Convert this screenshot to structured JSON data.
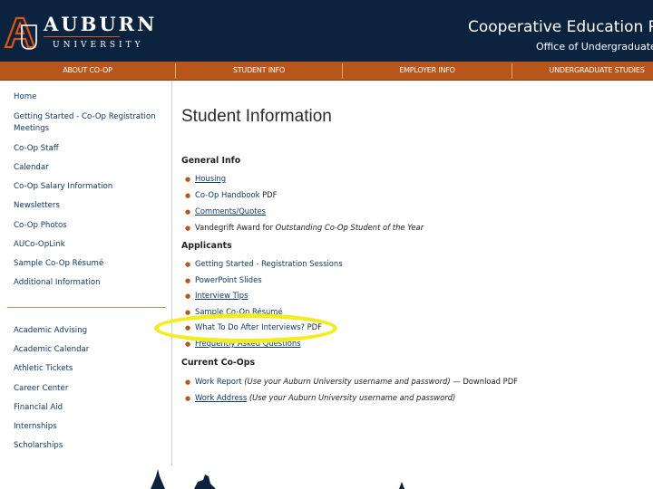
{
  "header": {
    "logo_word": "AUBURN",
    "logo_sub": "UNIVERSITY",
    "site_title": "Cooperative Education Progr",
    "site_subtitle": "Office of Undergraduate St"
  },
  "nav": {
    "items": [
      "ABOUT CO-OP",
      "STUDENT INFO",
      "EMPLOYER INFO",
      "UNDERGRADUATE STUDIES"
    ]
  },
  "sidebar": {
    "primary": [
      "Home",
      "Getting Started - Co-Op Registration",
      "Meetings",
      "Co-Op Staff",
      "Calendar",
      "Co-Op Salary Information",
      "Newsletters",
      "Co-Op Photos",
      "AUCo-OpLink",
      "Sample Co-Op Résumé",
      "Additional Information"
    ],
    "secondary": [
      "Academic Advising",
      "Academic Calendar",
      "Athletic Tickets",
      "Career Center",
      "Financial Aid",
      "Internships",
      "Scholarships"
    ]
  },
  "main": {
    "title": "Student Information",
    "general": {
      "heading": "General Info",
      "housing": "Housing",
      "handbook": "Co-Op Handbook",
      "handbook_pdf": "PDF",
      "comments": "Comments/Quotes",
      "award_prefix": "Vandegrift Award for",
      "award_italic": "Outstanding Co-Op Student of the Year"
    },
    "applicants": {
      "heading": "Applicants",
      "getting_started": "Getting Started - Registration Sessions",
      "powerpoint": "PowerPoint Slides",
      "interview_tips": "Interview Tips",
      "sample_resume": "Sample Co-Op Résumé",
      "what_to_do": "What To Do After Interviews?",
      "what_to_do_pdf": "PDF",
      "faq": "Frequently Asked Questions"
    },
    "current": {
      "heading": "Current Co-Ops",
      "work_report": "Work Report",
      "work_report_note": "(Use your Auburn University username and password)",
      "download_sep": "—",
      "download": "Download",
      "download_pdf": "PDF",
      "work_address": "Work Address",
      "work_address_note": "(Use your Auburn University username and password)"
    }
  },
  "colors": {
    "navy": "#0c2340",
    "orange": "#b8551a",
    "highlight": "#f2ee1e"
  }
}
